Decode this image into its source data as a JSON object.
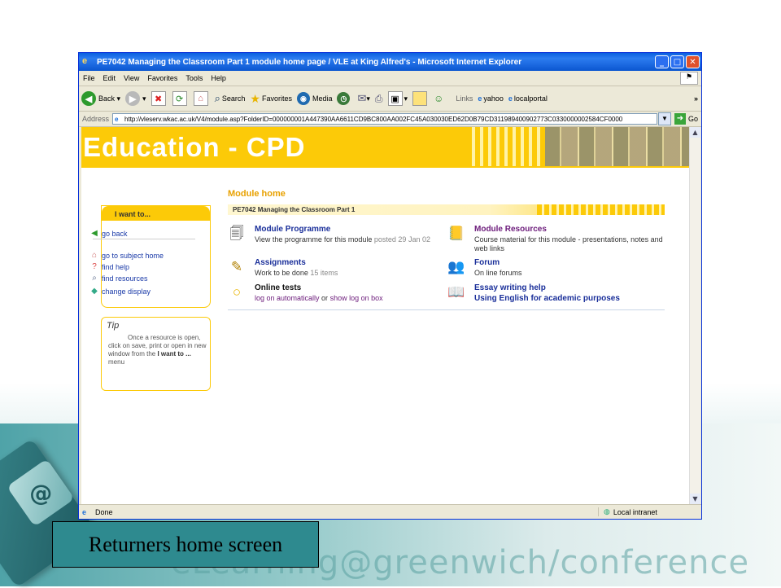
{
  "window": {
    "title": "PE7042 Managing the Classroom Part 1 module home page / VLE at King Alfred's - Microsoft Internet Explorer"
  },
  "menu": [
    "File",
    "Edit",
    "View",
    "Favorites",
    "Tools",
    "Help"
  ],
  "toolbar": {
    "back": "Back",
    "search": "Search",
    "favorites": "Favorites",
    "media": "Media",
    "links": "Links",
    "yahoo": "yahoo",
    "localportal": "localportal"
  },
  "address": {
    "label": "Address",
    "url": "http://vleserv.wkac.ac.uk/V4/module.asp?FolderID=000000001A447390AA6611CD9BC800AA002FC45A030030ED62D0B79CD311989400902773C0330000002584CF0000",
    "go": "Go"
  },
  "page": {
    "banner_title": "Education - CPD",
    "module_home": "Module home",
    "module_name": "PE7042 Managing the Classroom Part 1",
    "side_head": "I want to...",
    "side_links": {
      "go_back": "go back",
      "subject_home": "go to subject home",
      "find_help": "find help",
      "find_resources": "find resources",
      "change_display": "change display"
    },
    "tip": {
      "head": "Tip",
      "text": "Once a resource is open, click on save, print or open in new window from the ",
      "bold": "I want to ...",
      "tail": " menu"
    },
    "items": {
      "programme": {
        "title": "Module Programme",
        "desc": "View the programme for this module",
        "posted": " posted 29 Jan 02"
      },
      "resources": {
        "title": "Module Resources",
        "desc": "Course material for this module - presentations, notes and web links"
      },
      "assignments": {
        "title": "Assignments",
        "desc": "Work to be done",
        "count": " 15 items"
      },
      "forum": {
        "title": "Forum",
        "desc": "On line forums"
      },
      "tests": {
        "title": "Online tests",
        "link1": "log on automatically",
        "or": " or ",
        "link2": "show log on box"
      },
      "essay": {
        "title": "Essay writing help",
        "subtitle": "Using English for academic purposes"
      }
    }
  },
  "status": {
    "left": "Done",
    "zone": "Local intranet"
  },
  "slide": {
    "caption": "Returners home screen",
    "watermark": "eLearning@greenwich/conference"
  },
  "colors": {
    "banner": "#fcca08",
    "caption_bg": "#2e8a8f",
    "link_blue": "#1a2f9a",
    "link_purple": "#6b1a7a"
  }
}
